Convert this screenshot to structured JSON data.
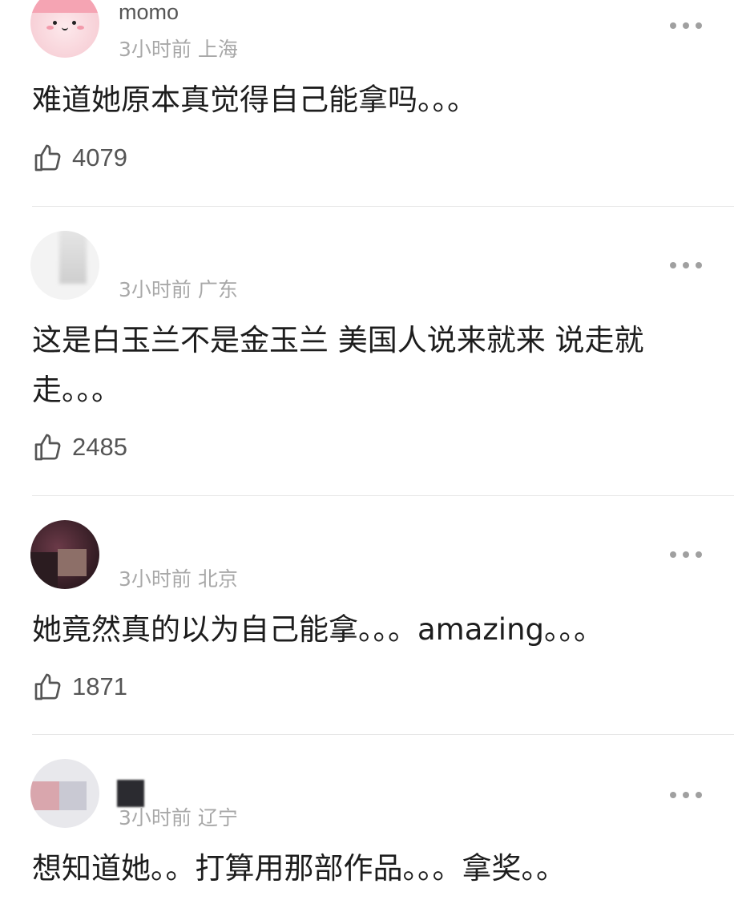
{
  "comments": [
    {
      "username": "momo",
      "meta": "3小时前 上海",
      "text": "难道她原本真觉得自己能拿吗。。。",
      "likes": "4079"
    },
    {
      "username": "",
      "meta": "3小时前 广东",
      "text": "这是白玉兰不是金玉兰 美国人说来就来 说走就走。。。",
      "likes": "2485"
    },
    {
      "username": "",
      "meta": "3小时前 北京",
      "text": "她竟然真的以为自己能拿。。。amazing。。。",
      "likes": "1871"
    },
    {
      "username": "",
      "meta": "3小时前 辽宁",
      "text": "想知道她。。打算用那部作品。。。拿奖。。",
      "likes": ""
    }
  ],
  "icons": {
    "like": "thumbs-up-icon",
    "more": "more-options-icon"
  },
  "colors": {
    "meta_text": "#a8a8a8",
    "divider": "#e7e7e7",
    "icon": "#555555"
  }
}
